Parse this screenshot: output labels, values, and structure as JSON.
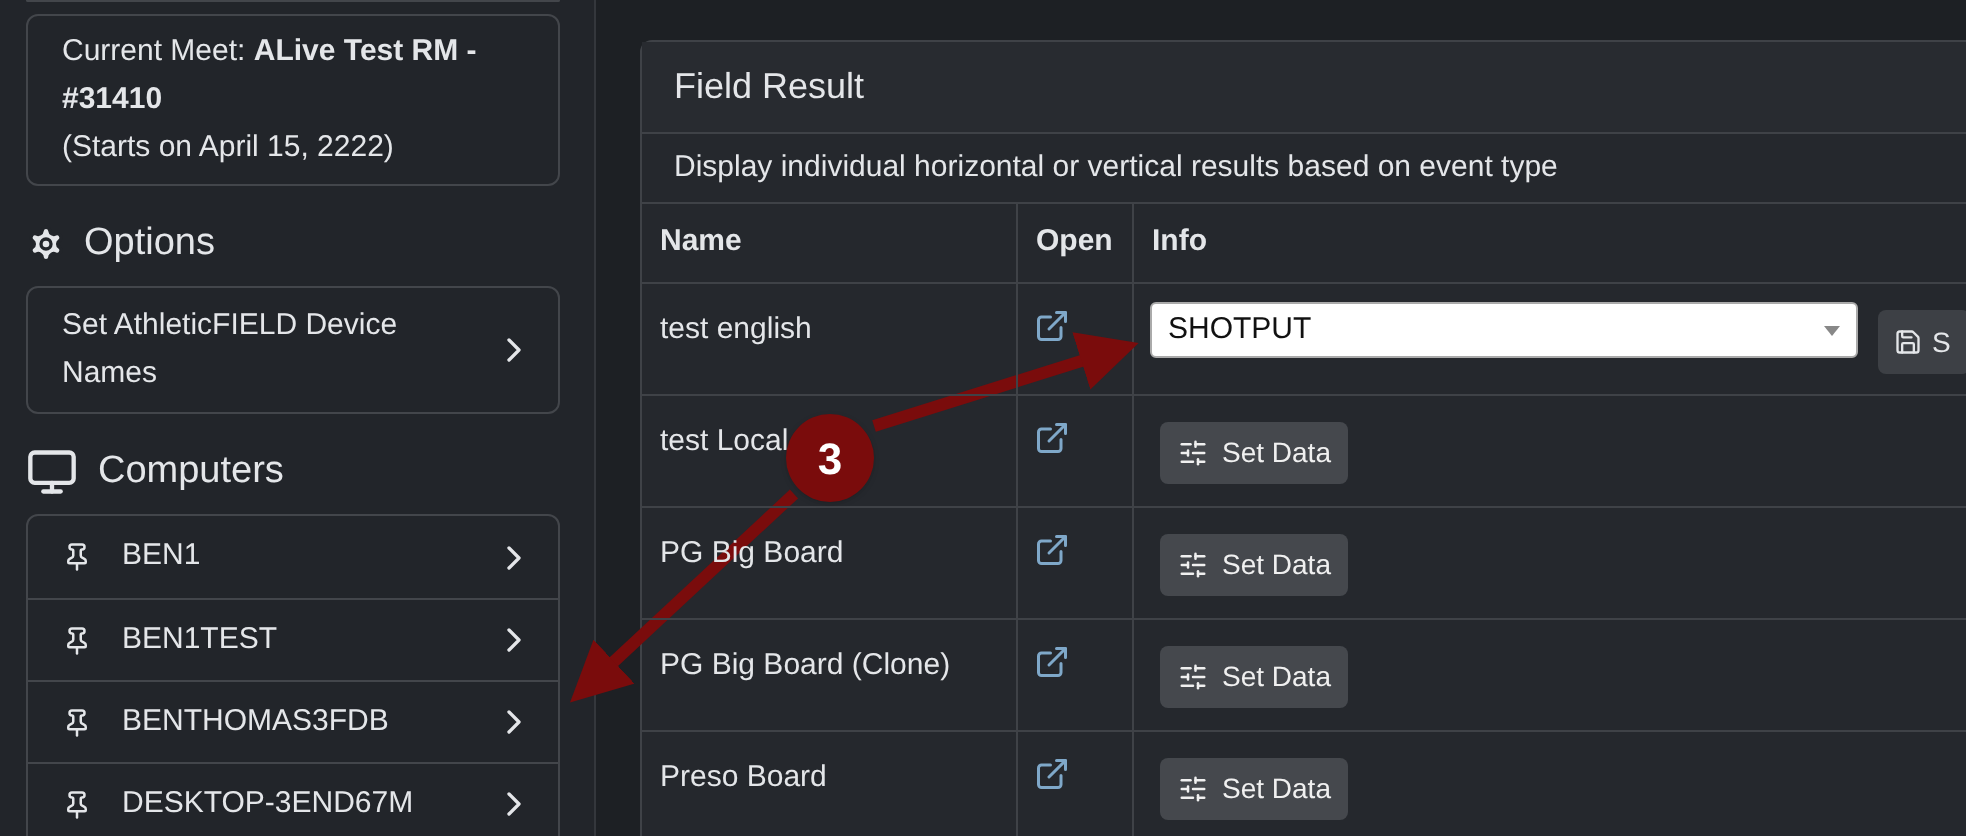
{
  "sidebar": {
    "current_meet": {
      "label": "Current Meet: ",
      "name": "ALive Test RM - #31410",
      "starts": "(Starts on April 15, 2222)"
    },
    "options": {
      "heading": "Options",
      "items": [
        "Set AthleticFIELD Device Names"
      ]
    },
    "computers": {
      "heading": "Computers",
      "items": [
        "BEN1",
        "BEN1TEST",
        "BENTHOMAS3FDB",
        "DESKTOP-3END67M"
      ]
    }
  },
  "card": {
    "title": "Field Result",
    "description": "Display individual horizontal or vertical results based on event type",
    "columns": [
      "Name",
      "Open",
      "Info"
    ],
    "rows": [
      {
        "name": "test english",
        "kind": "select",
        "value": "SHOTPUT",
        "save_label": "S"
      },
      {
        "name": "test Local",
        "kind": "button",
        "button": "Set Data"
      },
      {
        "name": "PG Big Board",
        "kind": "button",
        "button": "Set Data"
      },
      {
        "name": "PG Big Board (Clone)",
        "kind": "button",
        "button": "Set Data"
      },
      {
        "name": "Preso Board",
        "kind": "button",
        "button": "Set Data"
      }
    ]
  },
  "annotation": {
    "badge": "3"
  }
}
